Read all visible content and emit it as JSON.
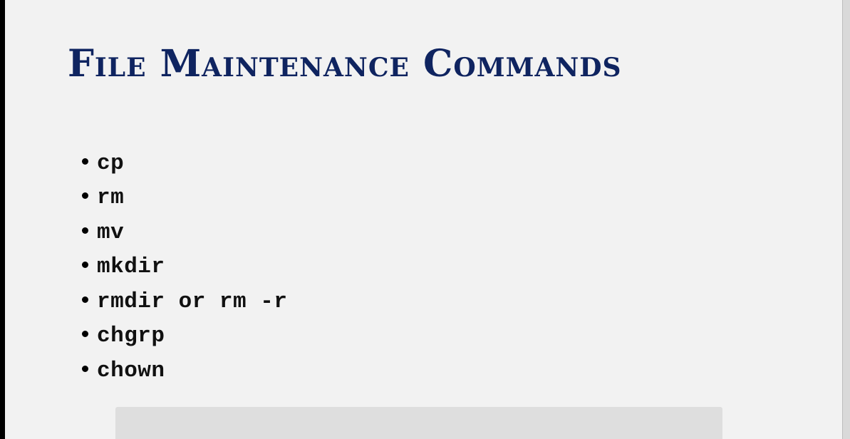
{
  "slide": {
    "title": "File Maintenance Commands",
    "bullets": [
      {
        "text": "cp"
      },
      {
        "text": "rm"
      },
      {
        "text": "mv"
      },
      {
        "text": "mkdir"
      },
      {
        "text": "rmdir or rm -r"
      },
      {
        "text": "chgrp"
      },
      {
        "text": "chown"
      }
    ]
  },
  "colors": {
    "title": "#0f2460",
    "background": "#f2f2f2",
    "text": "#111111"
  }
}
